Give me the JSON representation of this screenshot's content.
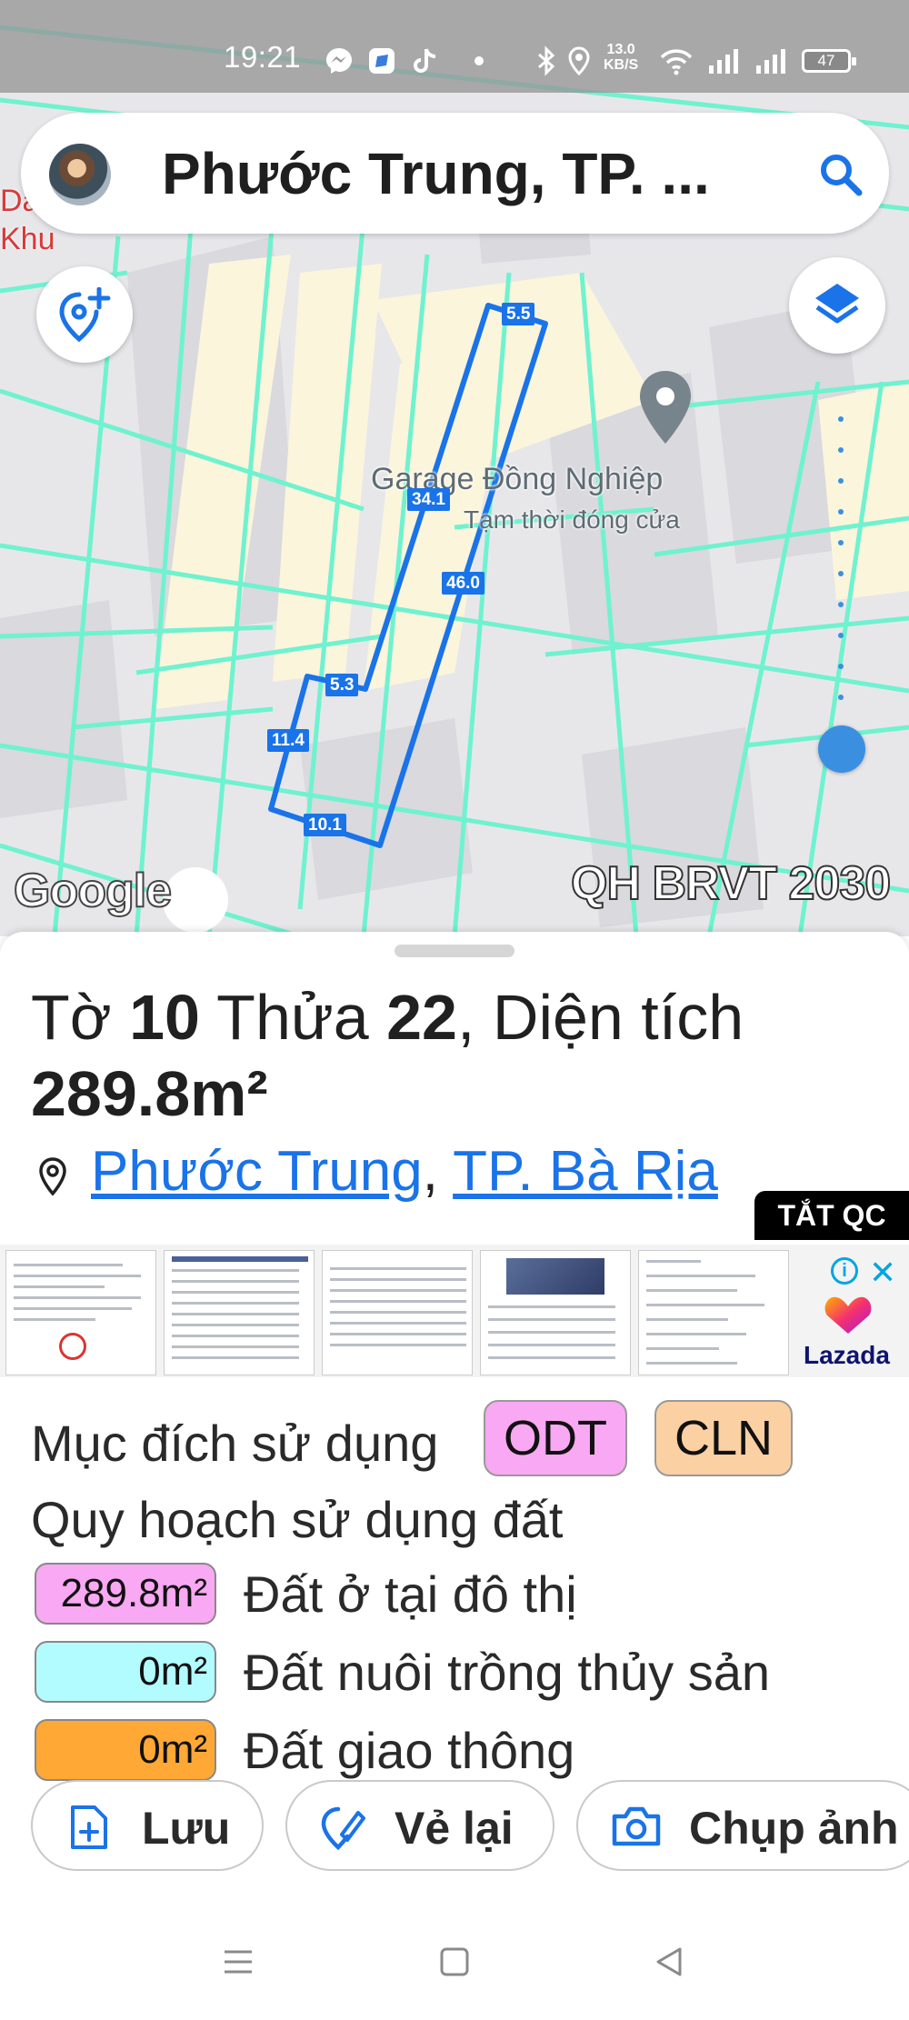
{
  "status_bar": {
    "time": "19:21",
    "net_speed_value": "13.0",
    "net_speed_unit": "KB/S",
    "battery": "47",
    "icons": [
      "messenger-icon",
      "app-icon",
      "tiktok-icon",
      "dot-icon",
      "bluetooth-icon",
      "location-icon",
      "wifi-icon",
      "signal-icon",
      "signal-icon"
    ]
  },
  "search": {
    "query": "Phước Trung, TP. ...",
    "icon": "search-icon"
  },
  "map": {
    "poi_name": "Garage Đồng Nghiệp",
    "poi_status": "Tạm thời đóng cửa",
    "ghost_label_line1": "Da Kh",
    "ghost_label_line2": "Khu",
    "dimensions": [
      "5.5",
      "34.1",
      "46.0",
      "5.3",
      "11.4",
      "10.1"
    ],
    "logo": "Google",
    "layer_name": "QH BRVT 2030",
    "colors": {
      "boundary": "#6ff2cf",
      "parcel": "#1a73e8",
      "residential": "#fbf5dc"
    }
  },
  "parcel": {
    "prefix_to": "Tờ ",
    "sheet_no": "10",
    "mid_thua": " Thửa ",
    "plot_no": "22",
    "mid_area": ", Diện tích",
    "area": "289.8m²",
    "ward": "Phước Trung",
    "separator": ",",
    "city": "TP. Bà Rịa"
  },
  "ad": {
    "close_label": "TẮT QC",
    "brand": "Lazada",
    "info_icon": "i",
    "close_icon": "✕"
  },
  "land_use": {
    "purpose_label": "Mục đích sử dụng",
    "tags": [
      {
        "code": "ODT",
        "color": "#f9a8f3"
      },
      {
        "code": "CLN",
        "color": "#fbd0a3"
      }
    ],
    "planning_label": "Quy hoạch sử dụng đất",
    "planning": [
      {
        "area": "289.8m²",
        "label": "Đất ở tại đô thị",
        "color": "#f9a8f3"
      },
      {
        "area": "0m²",
        "label": "Đất nuôi trồng thủy sản",
        "color": "#b2fbff"
      },
      {
        "area": "0m²",
        "label": "Đất giao thông",
        "color": "#ffa836"
      }
    ]
  },
  "actions": {
    "save": "Lưu",
    "redraw": "Vẻ lại",
    "capture": "Chụp ảnh"
  }
}
